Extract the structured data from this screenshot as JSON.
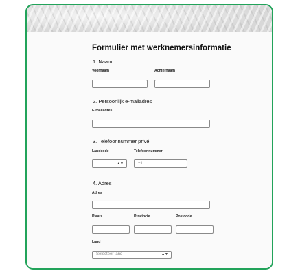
{
  "form": {
    "title": "Formulier met werknemersinformatie",
    "sections": {
      "naam": {
        "title": "1. Naam",
        "first_name_label": "Voornaam",
        "last_name_label": "Achternaam"
      },
      "email": {
        "title": "2. Persoonlijk e-mailadres",
        "email_label": "E-mailadres"
      },
      "phone": {
        "title": "3. Telefoonnummer privé",
        "country_code_label": "Landcode",
        "phone_label": "Telefoonnummer",
        "phone_placeholder": "+1"
      },
      "address": {
        "title": "4. Adres",
        "address_label": "Adres",
        "city_label": "Plaats",
        "province_label": "Provincie",
        "postcode_label": "Postcode",
        "country_label": "Land",
        "country_placeholder": "Selecteer land"
      }
    }
  },
  "icons": {
    "select_arrows": "up-down-arrows-icon"
  },
  "colors": {
    "frame_border": "#22a35a"
  }
}
